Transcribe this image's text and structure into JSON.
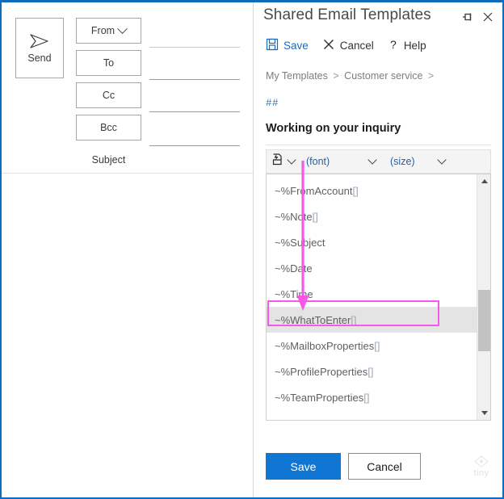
{
  "compose": {
    "send_button": {
      "label": "Send",
      "icon": "send-arrow-icon"
    },
    "fields": [
      {
        "label": "From",
        "has_chevron": true
      },
      {
        "label": "To",
        "has_chevron": false
      },
      {
        "label": "Cc",
        "has_chevron": false
      },
      {
        "label": "Bcc",
        "has_chevron": false
      }
    ],
    "subject_label": "Subject"
  },
  "panel": {
    "title": "Shared Email Templates",
    "pin_icon": "pin-icon",
    "close_icon": "close-icon",
    "commands": [
      {
        "label": "Save",
        "icon": "floppy-disk-icon"
      },
      {
        "label": "Cancel",
        "icon": "x-icon"
      },
      {
        "label": "Help",
        "icon": "question-mark-icon"
      }
    ],
    "breadcrumb": {
      "items": [
        "My Templates",
        "Customer service"
      ],
      "separator": ">"
    },
    "template": {
      "hash_line": "##",
      "title": "Working on your inquiry"
    },
    "toolbar": {
      "macro_icon": "insert-macro-icon",
      "font_label": "(font)",
      "size_label": "(size)"
    },
    "macro_dropdown": {
      "items": [
        {
          "text": "~%FromAccount[]",
          "selected": false
        },
        {
          "text": "~%Note[]",
          "selected": false
        },
        {
          "text": "~%Subject",
          "selected": false
        },
        {
          "text": "~%Date",
          "selected": false
        },
        {
          "text": "~%Time",
          "selected": false
        },
        {
          "text": "~%WhatToEnter[]",
          "selected": true
        },
        {
          "text": "~%MailboxProperties[]",
          "selected": false
        },
        {
          "text": "~%ProfileProperties[]",
          "selected": false
        },
        {
          "text": "~%TeamProperties[]",
          "selected": false
        }
      ]
    },
    "footer": {
      "save_label": "Save",
      "cancel_label": "Cancel",
      "watermark": "tiny"
    }
  },
  "colors": {
    "accent_blue": "#0f76d4",
    "link_blue": "#1a6bbd",
    "annotation_pink": "#f559e8",
    "window_border": "#0f6cbd",
    "selected_row": "#e4e4e4"
  }
}
